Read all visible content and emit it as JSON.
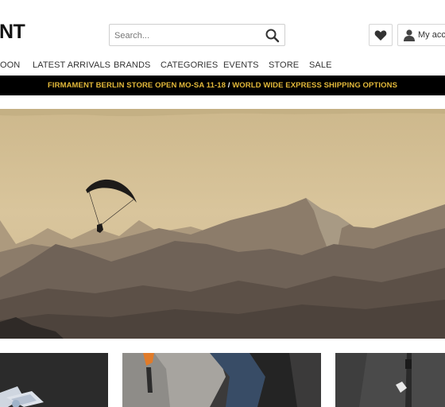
{
  "header": {
    "logo_text": "NT",
    "search": {
      "placeholder": "Search..."
    },
    "account_label": "My account"
  },
  "nav": {
    "items": [
      "OON",
      "LATEST ARRIVALS",
      "BRANDS",
      "CATEGORIES",
      "EVENTS",
      "STORE",
      "SALE"
    ]
  },
  "promo": {
    "part1": "FIRMAMENT BERLIN STORE OPEN MO-SA 11-18",
    "separator": "/",
    "part2": "WORLD WIDE EXPRESS SHIPPING OPTIONS"
  },
  "colors": {
    "promo_background": "#000000",
    "promo_text": "#e3b93a",
    "hero_sky": "#d8c398"
  },
  "icons": [
    "search-icon",
    "heart-icon",
    "user-icon"
  ]
}
